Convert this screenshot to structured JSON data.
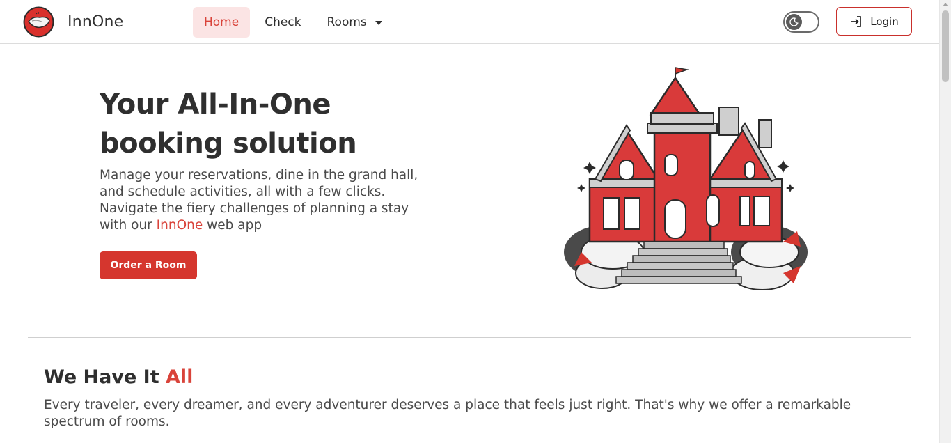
{
  "brand": {
    "name": "InnOne"
  },
  "nav": {
    "home": "Home",
    "check": "Check",
    "rooms": "Rooms"
  },
  "header": {
    "login_label": "Login"
  },
  "hero": {
    "title": "Your All-In-One booking solution",
    "text_before": "Manage your reservations, dine in the grand hall, and schedule activities, all with a few clicks. Navigate the fiery challenges of planning a stay with our ",
    "text_accent": "InnOne",
    "text_after": " web app",
    "cta_label": "Order a Room"
  },
  "section": {
    "title_main": "We Have It ",
    "title_accent": "All",
    "text": "Every traveler, every dreamer, and every adventurer deserves a place that feels just right. That's why we offer a remarkable spectrum of rooms."
  },
  "colors": {
    "accent": "#d9433a",
    "button": "#d5362e",
    "active_bg": "#fbe4e4"
  },
  "icons": {
    "logo": "inn-logo-icon",
    "theme": "moon-icon",
    "login": "login-arrow-icon",
    "caret": "chevron-down-icon"
  }
}
